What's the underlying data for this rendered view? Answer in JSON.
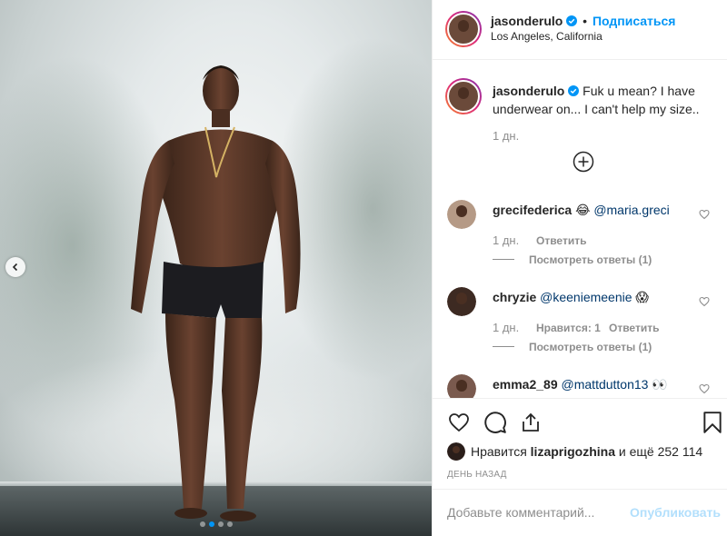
{
  "post": {
    "author": "jasonderulo",
    "follow_label": "Подписаться",
    "separator": "•",
    "location": "Los Angeles, California",
    "caption": {
      "username": "jasonderulo",
      "text_line1": "Fuk u mean? I have",
      "text_line2": "underwear on... I can't help my size..",
      "time": "1 дн."
    }
  },
  "comments": [
    {
      "username": "grecifederica",
      "emoji": "😂",
      "mention": "@maria.greci",
      "time": "1 дн.",
      "reply_label": "Ответить",
      "view_replies": "Посмотреть ответы (1)"
    },
    {
      "username": "chryzie",
      "mention": "@keeniemeenie",
      "emoji": "😱",
      "time": "1 дн.",
      "likes": "Нравится: 1",
      "reply_label": "Ответить",
      "view_replies": "Посмотреть ответы (1)"
    },
    {
      "username": "emma2_89",
      "mention": "@mattdutton13",
      "emoji": "👀"
    }
  ],
  "likes": {
    "prefix": "Нравится",
    "user": "lizaprigozhina",
    "suffix": "и ещё 252 114"
  },
  "timestamp": "ДЕНЬ НАЗАД",
  "add_comment": {
    "placeholder": "Добавьте комментарий...",
    "post_label": "Опубликовать"
  },
  "carousel": {
    "slide_count": 4,
    "active_index": 1
  },
  "colors": {
    "accent": "#0095f6",
    "link": "#00376b",
    "muted": "#8e8e8e",
    "post_disabled": "#b2dffc"
  }
}
